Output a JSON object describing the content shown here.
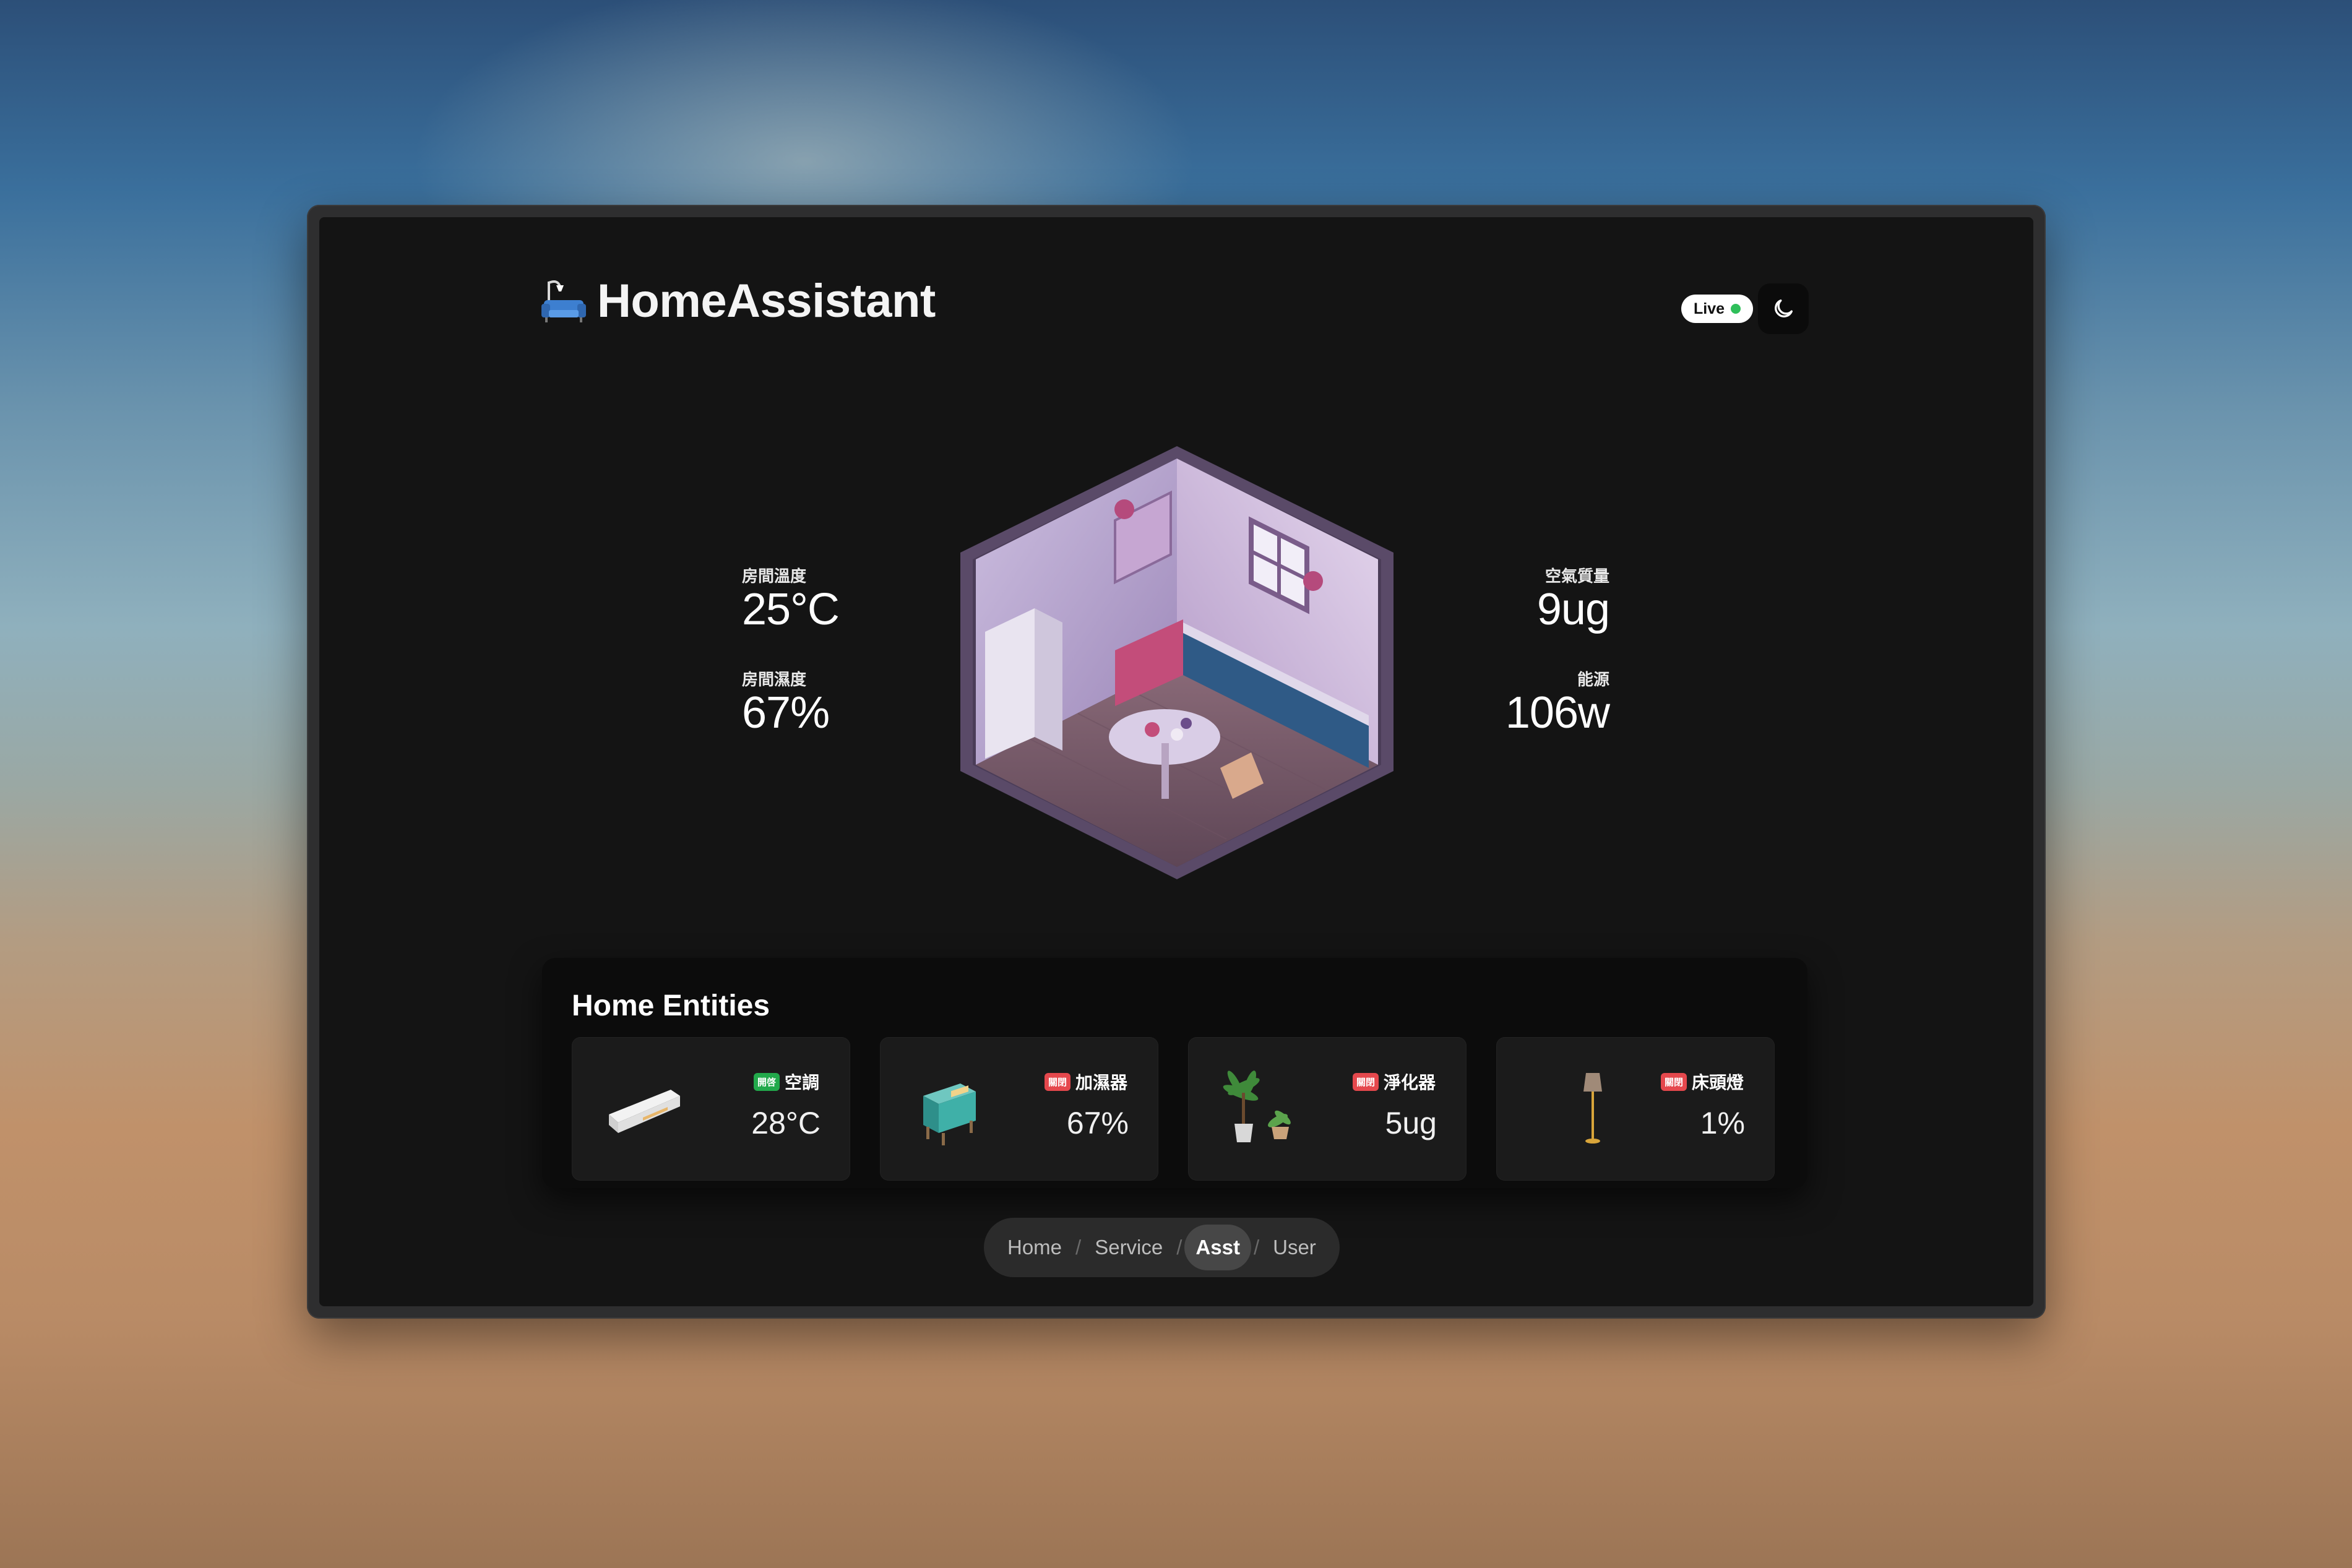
{
  "header": {
    "title": "HomeAssistant",
    "live_label": "Live",
    "logo_icon": "sofa-icon",
    "theme_icon": "moon-icon"
  },
  "stats": {
    "room_temp": {
      "label": "房間溫度",
      "value": "25°C"
    },
    "room_humidity": {
      "label": "房間濕度",
      "value": "67%"
    },
    "air_quality": {
      "label": "空氣質量",
      "value": "9ug"
    },
    "energy": {
      "label": "能源",
      "value": "106w"
    }
  },
  "entities": {
    "title": "Home Entities",
    "items": [
      {
        "name": "空調",
        "status": "開啓",
        "status_color": "#22a94b",
        "value": "28°C",
        "icon": "air-conditioner-icon"
      },
      {
        "name": "加濕器",
        "status": "關閉",
        "status_color": "#e5484d",
        "value": "67%",
        "icon": "humidifier-icon"
      },
      {
        "name": "淨化器",
        "status": "關閉",
        "status_color": "#e5484d",
        "value": "5ug",
        "icon": "plant-purifier-icon"
      },
      {
        "name": "床頭燈",
        "status": "關閉",
        "status_color": "#e5484d",
        "value": "1%",
        "icon": "floor-lamp-icon"
      }
    ]
  },
  "nav": {
    "items": [
      "Home",
      "Service",
      "Asst",
      "User"
    ],
    "separator": "/",
    "active": "Asst"
  }
}
